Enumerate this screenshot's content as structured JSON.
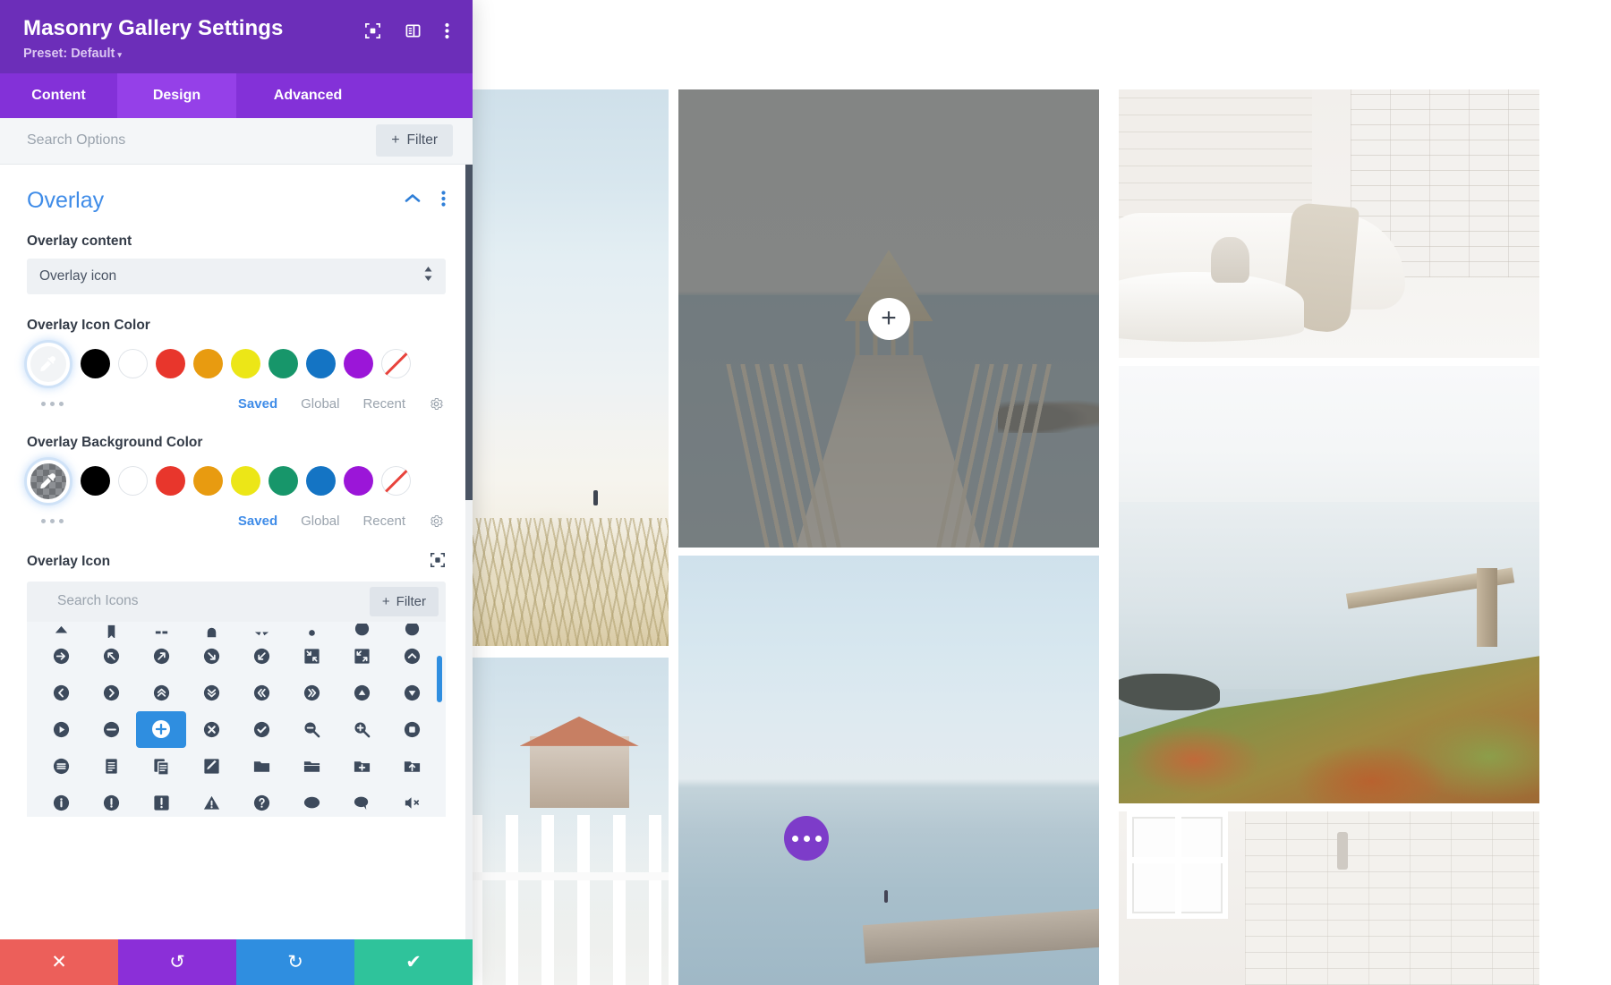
{
  "modal": {
    "title": "Masonry Gallery Settings",
    "preset_label": "Preset: Default",
    "preset_caret": "▾",
    "header_icons": [
      {
        "name": "focus-icon"
      },
      {
        "name": "layout-panel-icon"
      },
      {
        "name": "kebab-menu-icon"
      }
    ],
    "tabs": [
      {
        "label": "Content",
        "active": false
      },
      {
        "label": "Design",
        "active": true
      },
      {
        "label": "Advanced",
        "active": false
      }
    ],
    "search": {
      "placeholder": "Search Options",
      "value": "",
      "filter_label": "Filter",
      "filter_plus": "+"
    },
    "section": {
      "title": "Overlay",
      "collapse_icon": "chevron-up-icon",
      "menu_icon": "kebab-menu-icon"
    },
    "fields": {
      "overlay_content": {
        "label": "Overlay content",
        "value": "Overlay icon",
        "options": [
          "Overlay icon"
        ]
      },
      "overlay_icon_color": {
        "label": "Overlay Icon Color",
        "selected_swatch": "eyedropper-light",
        "swatches": [
          "#000000",
          "#ffffff",
          "#e8362c",
          "#e89b10",
          "#ece617",
          "#17966a",
          "#1474c4",
          "#9b16d8",
          "none"
        ],
        "meta": {
          "saved": "Saved",
          "global": "Global",
          "recent": "Recent",
          "active": "Saved",
          "gear": "gear-icon"
        },
        "more_dots": "more-options-dots"
      },
      "overlay_background_color": {
        "label": "Overlay Background Color",
        "selected_swatch": "eyedropper-transparent",
        "swatches": [
          "#000000",
          "#ffffff",
          "#e8362c",
          "#e89b10",
          "#ece617",
          "#17966a",
          "#1474c4",
          "#9b16d8",
          "none"
        ],
        "meta": {
          "saved": "Saved",
          "global": "Global",
          "recent": "Recent",
          "active": "Saved",
          "gear": "gear-icon"
        },
        "more_dots": "more-options-dots"
      },
      "overlay_icon": {
        "label": "Overlay Icon",
        "reset_icon": "focus-icon",
        "search_placeholder": "Search Icons",
        "search_value": "",
        "filter_label": "Filter",
        "filter_plus": "+",
        "selected_icon": "plus-circle-icon",
        "rows": [
          [
            "arrow-up-partial-icon",
            "bookmark-partial-icon",
            "arrows-partial-icon",
            "curve-partial-icon",
            "arrows-out-partial-icon",
            "gear-partial-icon",
            "chevron-down-partial-icon",
            "chevron-down2-partial-icon"
          ],
          [
            "arrow-right-circle-icon",
            "arrow-up-left-circle-icon",
            "arrow-up-right-circle-icon",
            "arrow-down-right-circle-icon",
            "arrow-down-left-circle-icon",
            "compress-square-icon",
            "expand-square-icon",
            "chevron-up-circle-icon"
          ],
          [
            "chevron-left-circle-icon",
            "chevron-right-circle-icon",
            "chevrons-up-circle-icon",
            "chevrons-down-circle-icon",
            "chevrons-left-circle-icon",
            "chevrons-right-circle-icon",
            "triangle-up-circle-icon",
            "triangle-down-circle-icon"
          ],
          [
            "play-circle-icon",
            "minus-circle-icon",
            "plus-circle-icon",
            "x-circle-icon",
            "check-circle-icon",
            "zoom-out-icon",
            "zoom-in-icon",
            "stop-circle-icon"
          ],
          [
            "menu-circle-icon",
            "document-lines-icon",
            "documents-copy-icon",
            "pencil-square-icon",
            "folder-icon",
            "folder-open-icon",
            "folder-plus-icon",
            "folder-upload-icon"
          ],
          [
            "info-circle-icon",
            "exclamation-circle-icon",
            "exclamation-square-icon",
            "warning-triangle-icon",
            "question-circle-icon",
            "chat-bubble-icon",
            "chat-bubble-tail-icon",
            "volume-mute-icon"
          ]
        ]
      }
    },
    "footer": [
      {
        "name": "discard-button",
        "icon": "✕"
      },
      {
        "name": "undo-button",
        "icon": "↺"
      },
      {
        "name": "redo-button",
        "icon": "↻"
      },
      {
        "name": "save-button",
        "icon": "✔"
      }
    ]
  },
  "gallery": {
    "overlay_plus_icon": "+",
    "divi_dots_label": "add-module-dots",
    "tiles": [
      {
        "name": "gallery-tile-dune",
        "alt": "white sand dune with distant figure"
      },
      {
        "name": "gallery-tile-pier",
        "alt": "wooden pier with thatched gazebo, hovered with overlay"
      },
      {
        "name": "gallery-tile-longpier",
        "alt": "long pier over calm sea"
      },
      {
        "name": "gallery-tile-fence",
        "alt": "white picket fence and cottage"
      },
      {
        "name": "gallery-tile-room",
        "alt": "white room with curved sofa and marble table"
      },
      {
        "name": "gallery-tile-pale",
        "alt": "pale white gradient"
      },
      {
        "name": "gallery-tile-cliff",
        "alt": "coastal cliff with plank and vegetation"
      },
      {
        "name": "gallery-tile-window",
        "alt": "white brick wall with window"
      }
    ]
  },
  "colors": {
    "brand_purple": "#6c2eb9",
    "tab_purple": "#8331d8",
    "tab_active_purple": "#9540e8",
    "accent_blue": "#3f8ce8",
    "selected_icon_blue": "#2f8ee0",
    "discard_red": "#ec5f5a",
    "undo_purple": "#8b2fd8",
    "redo_blue": "#2f8ee0",
    "save_green": "#2fc39b"
  }
}
